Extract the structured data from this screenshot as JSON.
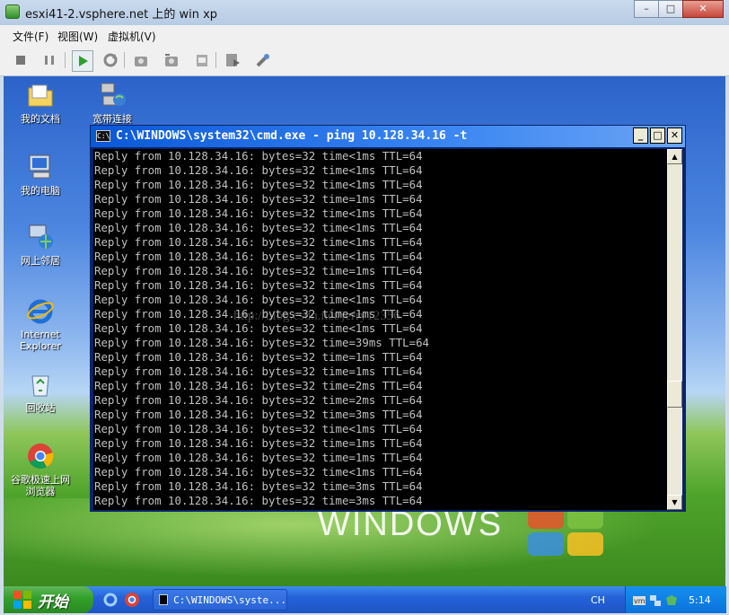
{
  "vm_window": {
    "title": "esxi41-2.vsphere.net 上的 win xp",
    "controls": {
      "minimize": "–",
      "maximize": "□",
      "close": "✕"
    }
  },
  "menu": {
    "items": [
      "文件(F)",
      "视图(W)",
      "虚拟机(V)"
    ]
  },
  "toolbar": {
    "buttons": [
      "stop-icon",
      "pause-icon",
      "play-icon",
      "reset-icon",
      "snapshot-icon",
      "revert-snapshot-icon",
      "manage-snapshots-icon",
      "console-settings-icon",
      "vm-tools-icon"
    ]
  },
  "desktop": {
    "icons": [
      {
        "label": "我的文档",
        "icon": "folder-icon"
      },
      {
        "label": "宽带连接",
        "icon": "network-connection-icon"
      },
      {
        "label": "我的电脑",
        "icon": "computer-icon"
      },
      {
        "label": "网上邻居",
        "icon": "network-places-icon"
      },
      {
        "label": "Internet Explorer",
        "icon": "ie-icon"
      },
      {
        "label": "回收站",
        "icon": "recycle-bin-icon"
      },
      {
        "label": "谷歌极速上网浏览器",
        "icon": "chrome-icon"
      }
    ],
    "wallpaper_text": "WINDOWS"
  },
  "cmd": {
    "title": "C:\\WINDOWS\\system32\\cmd.exe - ping 10.128.34.16 -t",
    "lines": [
      "Reply from 10.128.34.16: bytes=32 time<1ms TTL=64",
      "Reply from 10.128.34.16: bytes=32 time<1ms TTL=64",
      "Reply from 10.128.34.16: bytes=32 time<1ms TTL=64",
      "Reply from 10.128.34.16: bytes=32 time=1ms TTL=64",
      "Reply from 10.128.34.16: bytes=32 time<1ms TTL=64",
      "Reply from 10.128.34.16: bytes=32 time<1ms TTL=64",
      "Reply from 10.128.34.16: bytes=32 time<1ms TTL=64",
      "Reply from 10.128.34.16: bytes=32 time<1ms TTL=64",
      "Reply from 10.128.34.16: bytes=32 time=1ms TTL=64",
      "Reply from 10.128.34.16: bytes=32 time<1ms TTL=64",
      "Reply from 10.128.34.16: bytes=32 time<1ms TTL=64",
      "Reply from 10.128.34.16: bytes=32 time<1ms TTL=64",
      "Reply from 10.128.34.16: bytes=32 time<1ms TTL=64",
      "Reply from 10.128.34.16: bytes=32 time=39ms TTL=64",
      "Reply from 10.128.34.16: bytes=32 time=1ms TTL=64",
      "Reply from 10.128.34.16: bytes=32 time=1ms TTL=64",
      "Reply from 10.128.34.16: bytes=32 time=2ms TTL=64",
      "Reply from 10.128.34.16: bytes=32 time=2ms TTL=64",
      "Reply from 10.128.34.16: bytes=32 time=3ms TTL=64",
      "Reply from 10.128.34.16: bytes=32 time<1ms TTL=64",
      "Reply from 10.128.34.16: bytes=32 time=1ms TTL=64",
      "Reply from 10.128.34.16: bytes=32 time=1ms TTL=64",
      "Reply from 10.128.34.16: bytes=32 time<1ms TTL=64",
      "Reply from 10.128.34.16: bytes=32 time=3ms TTL=64",
      "Reply from 10.128.34.16: bytes=32 time=3ms TTL=64"
    ],
    "watermark": "http://blog.csdn.net/jerry12356"
  },
  "taskbar": {
    "start_label": "开始",
    "task_label": "C:\\WINDOWS\\syste...",
    "language": "CH",
    "clock": "5:14"
  }
}
